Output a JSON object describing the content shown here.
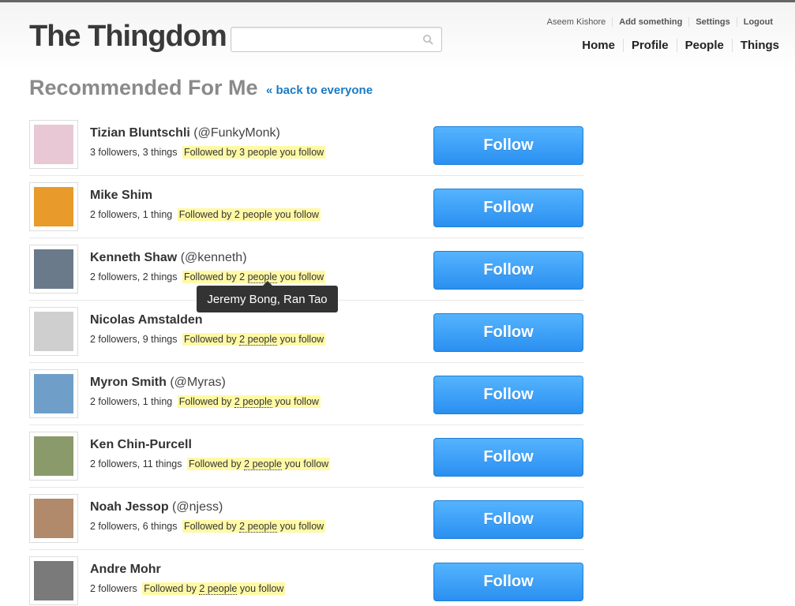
{
  "app": {
    "logo": "The Thingdom",
    "search_placeholder": ""
  },
  "util_nav": [
    "Aseem Kishore",
    "Add something",
    "Settings",
    "Logout"
  ],
  "main_nav": [
    "Home",
    "Profile",
    "People",
    "Things"
  ],
  "page": {
    "title": "Recommended For Me",
    "back_link": "« back to everyone"
  },
  "tooltip": "Jeremy Bong, Ran Tao",
  "follow_label": "Follow",
  "people": [
    {
      "name": "Tizian Bluntschli",
      "handle": "(@FunkyMonk)",
      "stats": "3 followers, 3 things",
      "pre": "Followed by 3 ",
      "link": "",
      "post": "people you follow"
    },
    {
      "name": "Mike Shim",
      "handle": "",
      "stats": "2 followers, 1 thing",
      "pre": "Followed by 2 ",
      "link": "",
      "post": "people you follow"
    },
    {
      "name": "Kenneth Shaw",
      "handle": "(@kenneth)",
      "stats": "2 followers, 2 things",
      "pre": "Followed by 2 ",
      "link": "people",
      "post": " you follow"
    },
    {
      "name": "Nicolas Amstalden",
      "handle": "",
      "stats": "2 followers, 9 things",
      "pre": "Followed by ",
      "link": "2 people",
      "post": " you follow"
    },
    {
      "name": "Myron Smith",
      "handle": "(@Myras)",
      "stats": "2 followers, 1 thing",
      "pre": "Followed by ",
      "link": "2 people",
      "post": " you follow"
    },
    {
      "name": "Ken Chin-Purcell",
      "handle": "",
      "stats": "2 followers, 11 things",
      "pre": "Followed by ",
      "link": "2 people",
      "post": " you follow"
    },
    {
      "name": "Noah Jessop",
      "handle": "(@njess)",
      "stats": "2 followers, 6 things",
      "pre": "Followed by ",
      "link": "2 people",
      "post": " you follow"
    },
    {
      "name": "Andre Mohr",
      "handle": "",
      "stats": "2 followers",
      "pre": "Followed by ",
      "link": "2 people",
      "post": " you follow"
    }
  ],
  "avatar_colors": [
    "#e8c8d4",
    "#e89a2a",
    "#6a7a8a",
    "#cfcfcf",
    "#6f9fc8",
    "#8a9a6a",
    "#b08a6a",
    "#7a7a7a"
  ]
}
